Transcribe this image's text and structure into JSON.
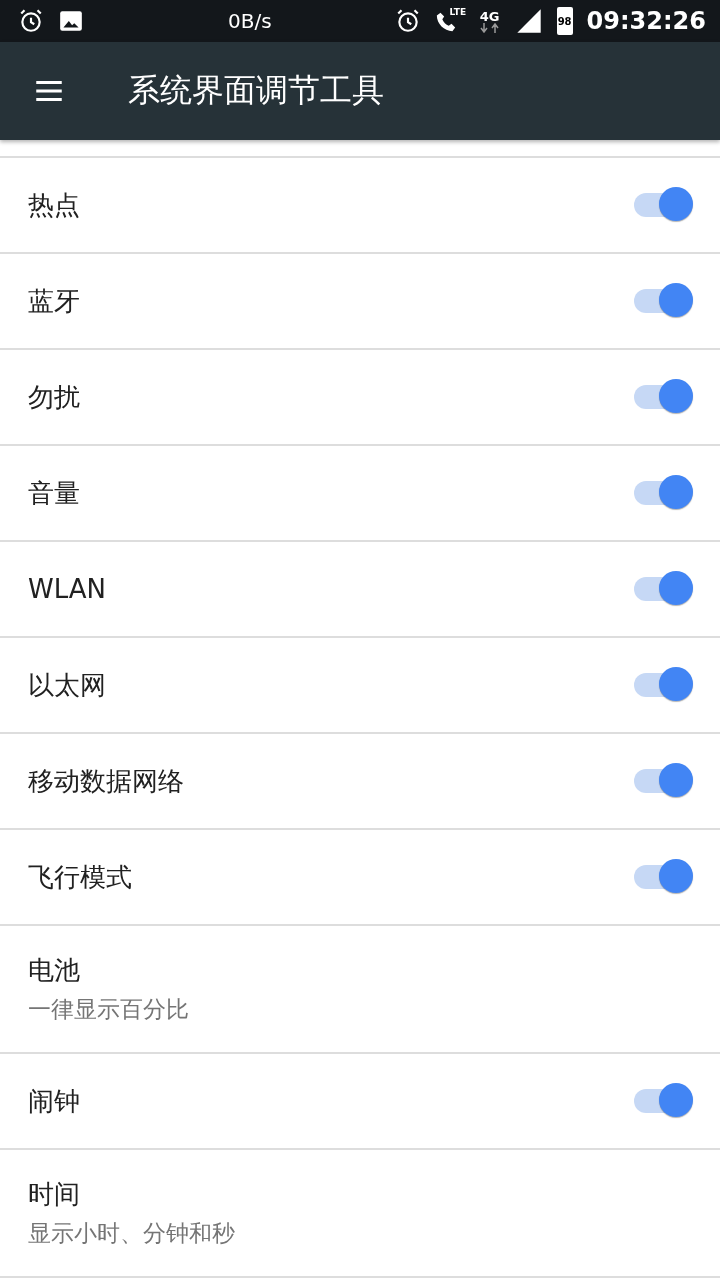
{
  "status_bar": {
    "speed": "0B/s",
    "call_badge": "LTE",
    "network": "4G",
    "battery": "98",
    "time": "09:32:26"
  },
  "app_bar": {
    "title": "系统界面调节工具"
  },
  "items": [
    {
      "kind": "switch",
      "label": "热点",
      "on": true
    },
    {
      "kind": "switch",
      "label": "蓝牙",
      "on": true
    },
    {
      "kind": "switch",
      "label": "勿扰",
      "on": true
    },
    {
      "kind": "switch",
      "label": "音量",
      "on": true
    },
    {
      "kind": "switch",
      "label": "WLAN",
      "on": true
    },
    {
      "kind": "switch",
      "label": "以太网",
      "on": true
    },
    {
      "kind": "switch",
      "label": "移动数据网络",
      "on": true
    },
    {
      "kind": "switch",
      "label": "飞行模式",
      "on": true
    },
    {
      "kind": "summary",
      "label": "电池",
      "summary": "一律显示百分比"
    },
    {
      "kind": "switch",
      "label": "闹钟",
      "on": true
    },
    {
      "kind": "summary",
      "label": "时间",
      "summary": "显示小时、分钟和秒"
    }
  ]
}
